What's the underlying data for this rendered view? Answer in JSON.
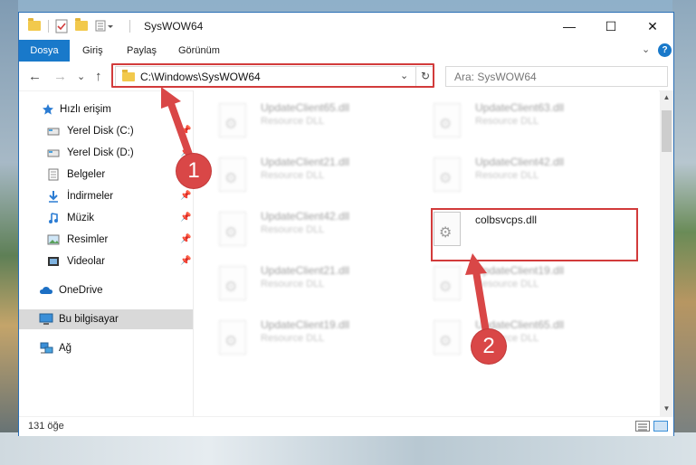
{
  "window": {
    "title": "SysWOW64",
    "controls": {
      "minimize": "—",
      "maximize": "☐",
      "close": "✕"
    }
  },
  "ribbon": {
    "tabs": [
      {
        "label": "Dosya",
        "active": true
      },
      {
        "label": "Giriş"
      },
      {
        "label": "Paylaş"
      },
      {
        "label": "Görünüm"
      }
    ],
    "expand_glyph": "⌄",
    "help_glyph": "?"
  },
  "nav": {
    "back": "←",
    "forward": "→",
    "recent": "⌄",
    "up": "↑",
    "address": "C:\\Windows\\SysWOW64",
    "address_dropdown": "⌄",
    "refresh": "↻",
    "search_placeholder": "Ara: SysWOW64"
  },
  "sidebar": {
    "items": [
      {
        "label": "Hızlı erişim",
        "icon": "star-icon"
      },
      {
        "label": "Yerel Disk (C:)",
        "icon": "drive-icon",
        "pinned": true
      },
      {
        "label": "Yerel Disk (D:)",
        "icon": "drive-icon",
        "pinned": true
      },
      {
        "label": "Belgeler",
        "icon": "documents-icon",
        "pinned": true
      },
      {
        "label": "İndirmeler",
        "icon": "download-icon",
        "pinned": true
      },
      {
        "label": "Müzik",
        "icon": "music-icon",
        "pinned": true
      },
      {
        "label": "Resimler",
        "icon": "pictures-icon",
        "pinned": true
      },
      {
        "label": "Videolar",
        "icon": "videos-icon",
        "pinned": true
      },
      {
        "label": "OneDrive",
        "icon": "cloud-icon"
      },
      {
        "label": "Bu bilgisayar",
        "icon": "computer-icon",
        "selected": true
      },
      {
        "label": "Ağ",
        "icon": "network-icon"
      }
    ],
    "pin_glyph": "📌"
  },
  "files": [
    {
      "name": "UpdateClient65.dll",
      "type": "Resource DLL",
      "blurred": true
    },
    {
      "name": "UpdateClient63.dll",
      "type": "Resource DLL",
      "blurred": true
    },
    {
      "name": "UpdateClient21.dll",
      "type": "Resource DLL",
      "blurred": true
    },
    {
      "name": "UpdateClient42.dll",
      "type": "Resource DLL",
      "blurred": true
    },
    {
      "name": "UpdateClient42.dll",
      "type": "Resource DLL",
      "blurred": true
    },
    {
      "name": "colbsvcps.dll",
      "type": "",
      "blurred": false
    },
    {
      "name": "UpdateClient21.dll",
      "type": "Resource DLL",
      "blurred": true
    },
    {
      "name": "UpdateClient19.dll",
      "type": "Resource DLL",
      "blurred": true
    },
    {
      "name": "UpdateClient19.dll",
      "type": "Resource DLL",
      "blurred": true
    },
    {
      "name": "UpdateClient65.dll",
      "type": "Resource DLL",
      "blurred": true
    }
  ],
  "status": {
    "count": "131 öğe"
  },
  "callouts": [
    {
      "number": "1"
    },
    {
      "number": "2"
    }
  ],
  "colors": {
    "accent": "#1979ca",
    "highlight": "#d23b3b",
    "badge": "#d94747"
  }
}
